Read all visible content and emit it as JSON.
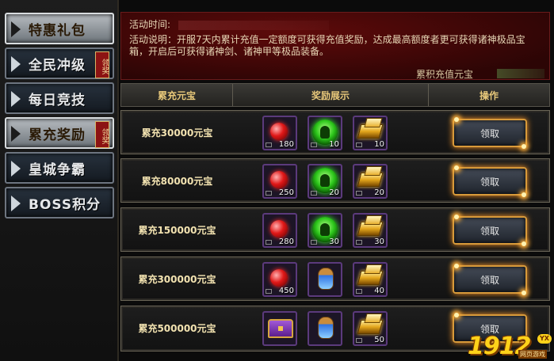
{
  "sidebar": {
    "items": [
      {
        "label": "特惠礼包",
        "active": true,
        "badge": ""
      },
      {
        "label": "全民冲级",
        "active": false,
        "badge": "领奖"
      },
      {
        "label": "每日竞技",
        "active": false,
        "badge": ""
      },
      {
        "label": "累充奖励",
        "active": true,
        "badge": "领奖"
      },
      {
        "label": "皇城争霸",
        "active": false,
        "badge": ""
      },
      {
        "label": "BOSS积分",
        "active": false,
        "badge": ""
      }
    ]
  },
  "info": {
    "time_label": "活动时间:",
    "desc": "活动说明：开服7天内累计充值一定额度可获得充值奖励，达成最高额度者更可获得诸神极品宝箱，开启后可获得诸神剑、诸神甲等极品装备。",
    "total_label": "累积充值元宝"
  },
  "table": {
    "headers": [
      "累充元宝",
      "奖励展示",
      "操作"
    ],
    "claim_label": "领取",
    "rows": [
      {
        "tier": "累充30000元宝",
        "rewards": [
          {
            "icon": "ruby-gem-icon",
            "qty": "180"
          },
          {
            "icon": "jade-orb-icon",
            "qty": "10"
          },
          {
            "icon": "gold-bar-icon",
            "qty": "10"
          }
        ]
      },
      {
        "tier": "累充80000元宝",
        "rewards": [
          {
            "icon": "ruby-gem-icon",
            "qty": "250"
          },
          {
            "icon": "jade-orb-icon",
            "qty": "20"
          },
          {
            "icon": "gold-bar-icon",
            "qty": "20"
          }
        ]
      },
      {
        "tier": "累充150000元宝",
        "rewards": [
          {
            "icon": "ruby-gem-icon",
            "qty": "280"
          },
          {
            "icon": "jade-orb-icon",
            "qty": "30"
          },
          {
            "icon": "gold-bar-icon",
            "qty": "30"
          }
        ]
      },
      {
        "tier": "累充300000元宝",
        "rewards": [
          {
            "icon": "ruby-gem-icon",
            "qty": "450"
          },
          {
            "icon": "potion-jar-icon",
            "qty": ""
          },
          {
            "icon": "gold-bar-icon",
            "qty": "40"
          }
        ]
      },
      {
        "tier": "累充500000元宝",
        "rewards": [
          {
            "icon": "treasure-chest-icon",
            "qty": ""
          },
          {
            "icon": "potion-jar-icon",
            "qty": ""
          },
          {
            "icon": "gold-bar-icon",
            "qty": "50"
          }
        ]
      }
    ]
  },
  "watermark": {
    "number": "1912",
    "tag": "YX",
    "site": "网页游戏"
  }
}
